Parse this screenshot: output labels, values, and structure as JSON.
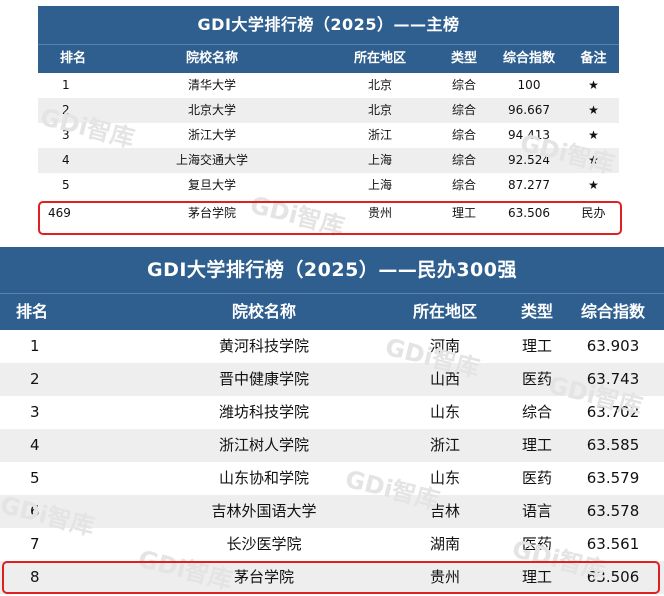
{
  "watermark": "GDi智库",
  "main_table": {
    "title": "GDI大学排行榜（2025）——主榜",
    "headers": [
      "排名",
      "院校名称",
      "所在地区",
      "类型",
      "综合指数",
      "备注"
    ],
    "rows": [
      [
        "1",
        "清华大学",
        "北京",
        "综合",
        "100",
        "★"
      ],
      [
        "2",
        "北京大学",
        "北京",
        "综合",
        "96.667",
        "★"
      ],
      [
        "3",
        "浙江大学",
        "浙江",
        "综合",
        "94.413",
        "★"
      ],
      [
        "4",
        "上海交通大学",
        "上海",
        "综合",
        "92.524",
        "★"
      ],
      [
        "5",
        "复旦大学",
        "上海",
        "综合",
        "87.277",
        "★"
      ],
      [
        "469",
        "茅台学院",
        "贵州",
        "理工",
        "63.506",
        "民办"
      ]
    ]
  },
  "private_table": {
    "title": "GDI大学排行榜（2025）——民办300强",
    "headers": [
      "排名",
      "院校名称",
      "所在地区",
      "类型",
      "综合指数"
    ],
    "rows": [
      [
        "1",
        "黄河科技学院",
        "河南",
        "理工",
        "63.903"
      ],
      [
        "2",
        "晋中健康学院",
        "山西",
        "医药",
        "63.743"
      ],
      [
        "3",
        "潍坊科技学院",
        "山东",
        "综合",
        "63.702"
      ],
      [
        "4",
        "浙江树人学院",
        "浙江",
        "理工",
        "63.585"
      ],
      [
        "5",
        "山东协和学院",
        "山东",
        "医药",
        "63.579"
      ],
      [
        "6",
        "吉林外国语大学",
        "吉林",
        "语言",
        "63.578"
      ],
      [
        "7",
        "长沙医学院",
        "湖南",
        "医药",
        "63.561"
      ],
      [
        "8",
        "茅台学院",
        "贵州",
        "理工",
        "63.506"
      ]
    ]
  },
  "colors": {
    "header_bg": "#2f5f8f",
    "highlight_border": "#e02020",
    "alt_row": "#eeeeee"
  }
}
